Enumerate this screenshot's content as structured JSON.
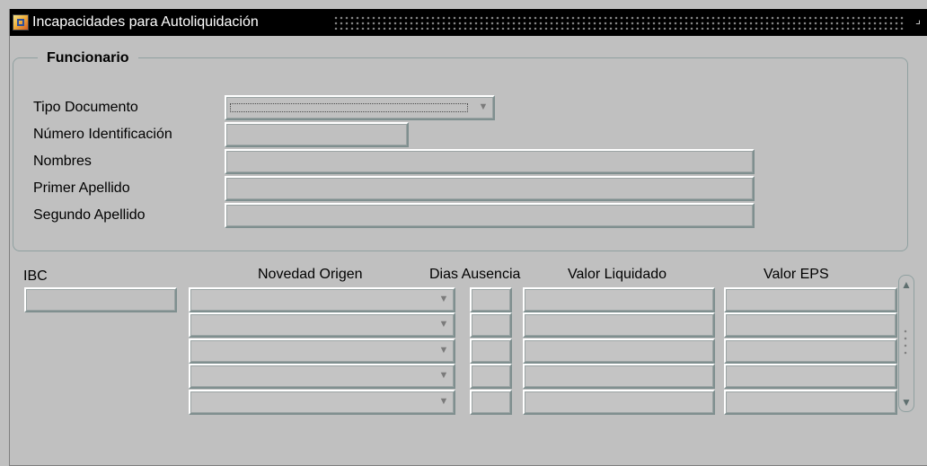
{
  "window": {
    "title": "Incapacidades para Autoliquidación",
    "icon": "form-window-icon",
    "resize_icon": "resize-window-icon"
  },
  "funcionario": {
    "title": "Funcionario",
    "fields": [
      {
        "label": "Tipo Documento",
        "value": "",
        "type": "dropdown"
      },
      {
        "label": "Número Identificación",
        "value": ""
      },
      {
        "label": "Nombres",
        "value": ""
      },
      {
        "label": "Primer Apellido",
        "value": ""
      },
      {
        "label": "Segundo Apellido",
        "value": ""
      }
    ]
  },
  "ibc": {
    "label": "IBC",
    "value": ""
  },
  "table": {
    "columns": [
      "Novedad Origen",
      "Dias Ausencia",
      "Valor Liquidado",
      "Valor EPS"
    ],
    "rows": [
      [
        "",
        "",
        "",
        ""
      ],
      [
        "",
        "",
        "",
        ""
      ],
      [
        "",
        "",
        "",
        ""
      ],
      [
        "",
        "",
        "",
        ""
      ],
      [
        "",
        "",
        "",
        ""
      ]
    ]
  },
  "icons": {
    "dropdown": "chevron-down-icon",
    "scroll_up": "arrow-up-icon",
    "scroll_down": "arrow-down-icon"
  }
}
